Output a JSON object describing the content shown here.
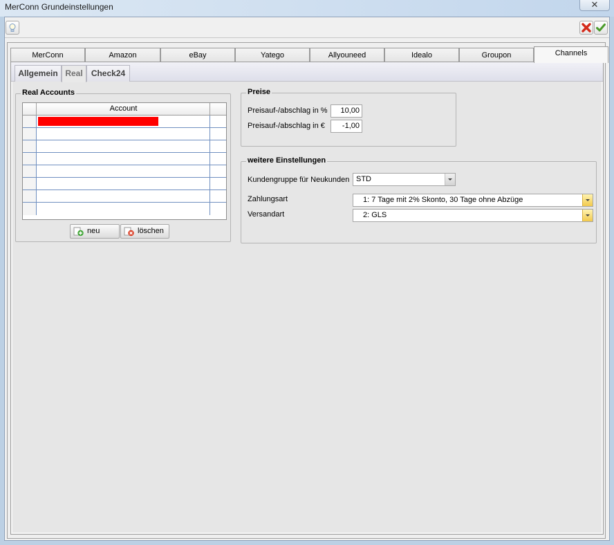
{
  "window": {
    "title": "MerConn Grundeinstellungen",
    "close_glyph": "✕"
  },
  "toolbar": {
    "help_icon": "lightbulb-icon",
    "cancel_icon": "red-x-icon",
    "ok_icon": "green-check-icon"
  },
  "main_tabs": [
    "MerConn",
    "Amazon",
    "eBay",
    "Yatego",
    "Allyouneed",
    "Idealo",
    "Groupon",
    "Channels"
  ],
  "main_tab_active": "Channels",
  "sub_tabs": [
    "Allgemein",
    "Real",
    "Check24"
  ],
  "sub_tab_active": "Real",
  "accounts": {
    "title": "Real Accounts",
    "column_header": "Account",
    "rows": [
      "[redacted]",
      "",
      "",
      "",
      "",
      "",
      "",
      ""
    ],
    "new_label": "neu",
    "delete_label": "löschen"
  },
  "preise": {
    "title": "Preise",
    "pct_label": "Preisauf-/abschlag in %",
    "pct_value": "10,00",
    "eur_label": "Preisauf-/abschlag in €",
    "eur_value": "-1,00"
  },
  "weitere": {
    "title": "weitere Einstellungen",
    "kundengruppe_label": "Kundengruppe für Neukunden",
    "kundengruppe_value": "STD",
    "zahlungsart_label": "Zahlungsart",
    "zahlungsart_value": "1: 7 Tage mit 2% Skonto, 30 Tage ohne Abzüge",
    "versandart_label": "Versandart",
    "versandart_value": "2: GLS"
  },
  "colors": {
    "redaction": "#ff0000",
    "combo_arrow_accent": "#f2c94c"
  }
}
